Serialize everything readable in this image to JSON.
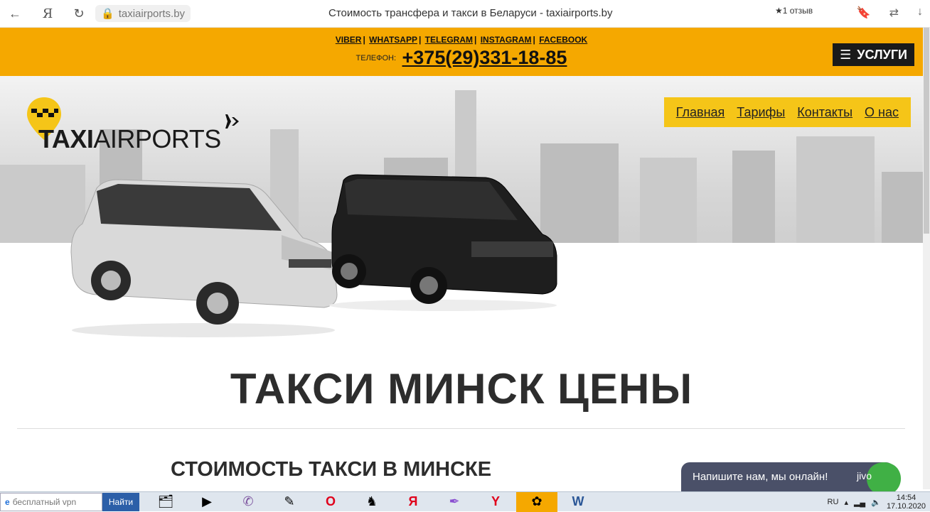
{
  "browser": {
    "url": "taxiairports.by",
    "title": "Стоимость трансфера и такси в Беларуси - taxiairports.by",
    "review": "1 отзыв",
    "icons": [
      "back-icon",
      "yandex-icon",
      "reload-icon",
      "lock-icon",
      "bookmark-icon",
      "translate-icon",
      "download-icon"
    ]
  },
  "header": {
    "social": [
      "VIBER",
      "WHATSAPP",
      "TELEGRAM",
      "INSTAGRAM",
      "FACEBOOK"
    ],
    "phone_label": "ТЕЛЕФОН:",
    "phone": "+375(29)331-18-85",
    "services_label": "УСЛУГИ",
    "accent": "#f5a800"
  },
  "hero": {
    "logo": {
      "taxi": "TAXI",
      "airports": "AIRPORTS"
    },
    "menu": [
      "Главная",
      "Тарифы",
      "Контакты",
      "О нас"
    ],
    "menu_color": "#f5c518"
  },
  "main": {
    "heading": "ТАКСИ МИНСК ЦЕНЫ",
    "subheading": "СТОИМОСТЬ ТАКСИ В МИНСКЕ"
  },
  "chat": {
    "text": "Напишите нам, мы онлайн!",
    "brand": "jivo"
  },
  "taskbar": {
    "search_placeholder": "бесплатный vpn",
    "find_label": "Найти",
    "lang": "RU",
    "time": "14:54",
    "date": "17.10.2020"
  }
}
